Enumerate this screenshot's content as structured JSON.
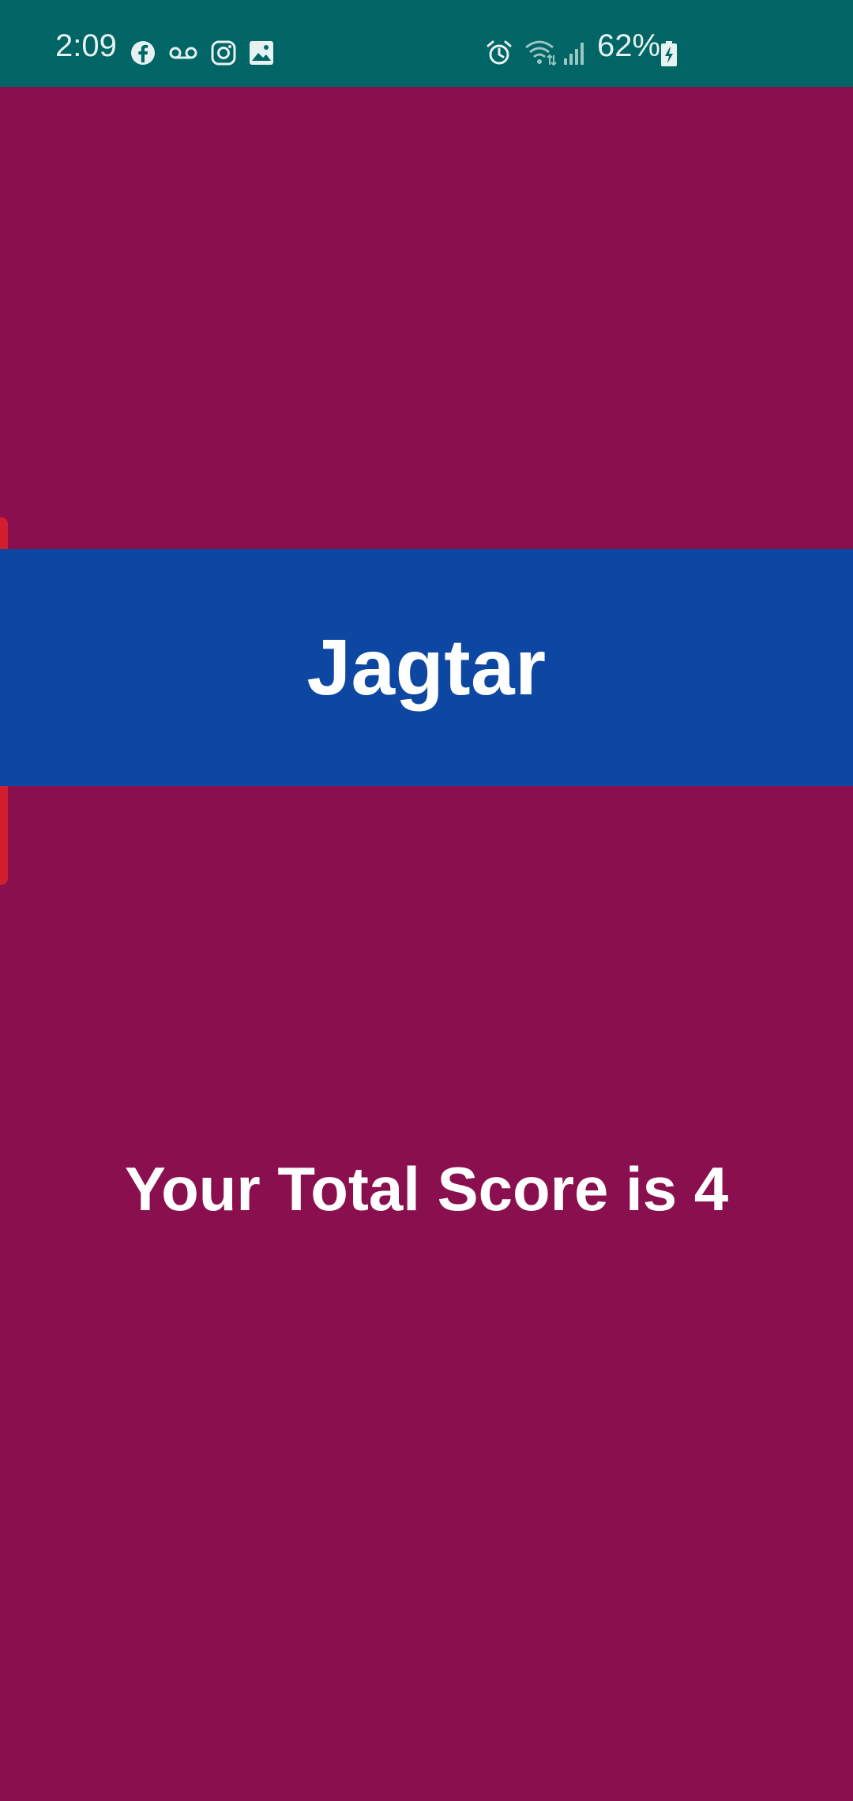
{
  "status_bar": {
    "time": "2:09",
    "battery_percent": "62%",
    "background_color": "#016566",
    "left_icons": [
      "facebook-icon",
      "voicemail-icon",
      "instagram-icon",
      "gallery-icon"
    ],
    "right_icons": [
      "alarm-icon",
      "wifi-icon",
      "signal-icon",
      "battery-charging-icon"
    ]
  },
  "page": {
    "background_color": "#8a0f4e"
  },
  "banner": {
    "name": "Jagtar",
    "background_color": "#0e47a1"
  },
  "result": {
    "score_text": "Your Total Score is 4"
  }
}
